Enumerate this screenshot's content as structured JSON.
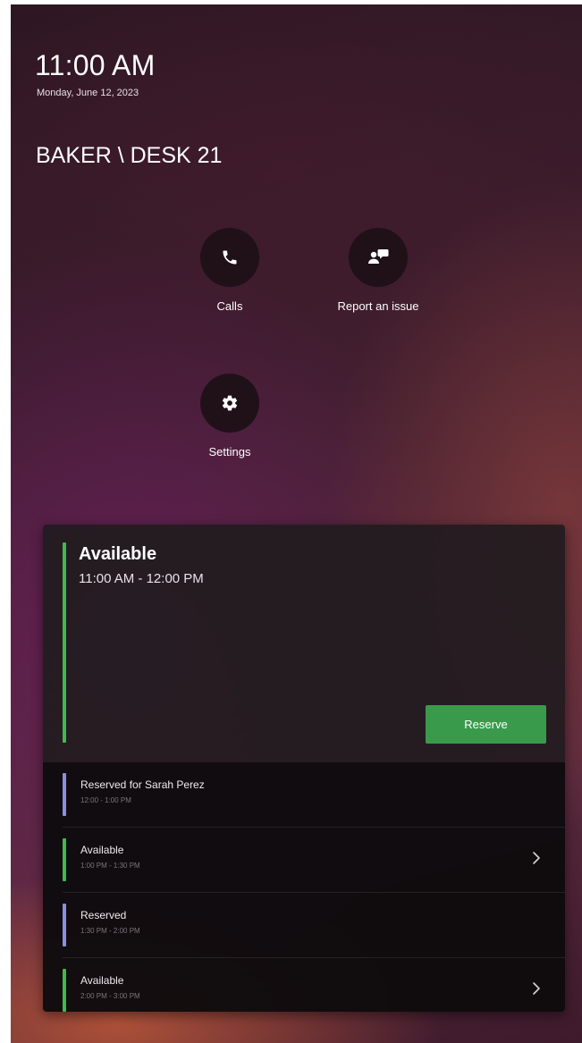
{
  "header": {
    "time": "11:00 AM",
    "date": "Monday, June 12, 2023",
    "location": "BAKER \\ DESK 21"
  },
  "actions": [
    {
      "label": "Calls",
      "icon": "phone-icon"
    },
    {
      "label": "Report an issue",
      "icon": "report-issue-icon"
    },
    {
      "label": "Settings",
      "icon": "gear-icon"
    }
  ],
  "current": {
    "status": "Available",
    "time": "11:00 AM - 12:00 PM",
    "reserve_label": "Reserve",
    "accent": "#3fb950"
  },
  "schedule": [
    {
      "title": "Reserved for Sarah Perez",
      "time": "12:00 - 1:00 PM",
      "color": "#8a8fe0",
      "chevron": false
    },
    {
      "title": "Available",
      "time": "1:00 PM - 1:30 PM",
      "color": "#3fb950",
      "chevron": true
    },
    {
      "title": "Reserved",
      "time": "1:30 PM - 2:00 PM",
      "color": "#8a8fe0",
      "chevron": false
    },
    {
      "title": "Available",
      "time": "2:00 PM - 3:00 PM",
      "color": "#3fb950",
      "chevron": true
    }
  ],
  "colors": {
    "available": "#3fb950",
    "reserved": "#8a8fe0",
    "reserve_button": "#3a9a4c"
  }
}
